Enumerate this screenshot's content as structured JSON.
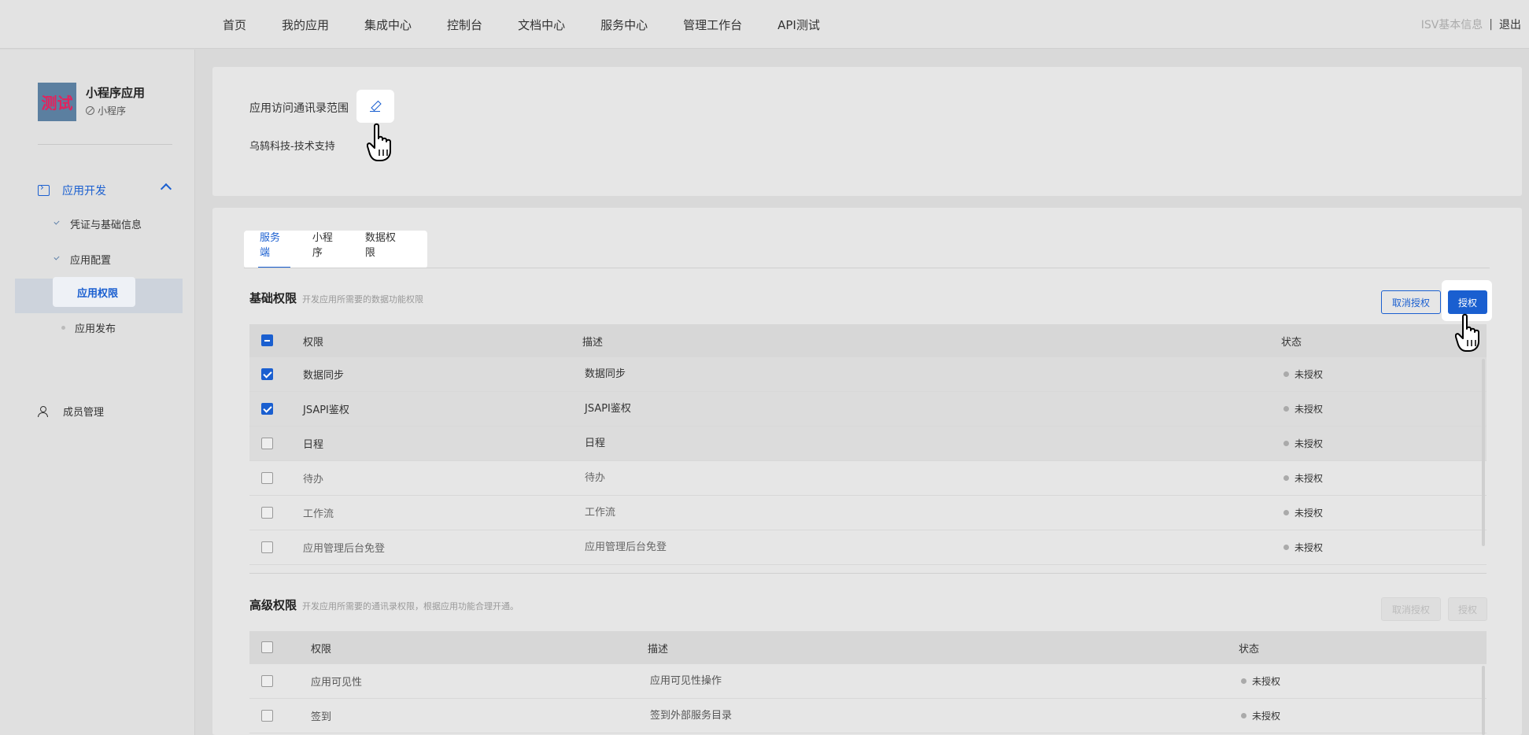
{
  "topnav": {
    "items": [
      "首页",
      "我的应用",
      "集成中心",
      "控制台",
      "文档中心",
      "服务中心",
      "管理工作台",
      "API测试"
    ],
    "isv": "ISV基本信息",
    "separator": "|",
    "logout": "退出"
  },
  "sidebar": {
    "app_logo_text": "测试",
    "app_name": "小程序应用",
    "app_type": "小程序",
    "group_label": "应用开发",
    "sub_items": [
      "凭证与基础信息",
      "应用配置",
      "应用权限",
      "应用发布"
    ],
    "member_label": "成员管理"
  },
  "scope": {
    "label": "应用访问通讯录范围",
    "value": "乌鸫科技-技术支持"
  },
  "tabs": [
    "服务端",
    "小程序",
    "数据权限"
  ],
  "basic": {
    "title": "基础权限",
    "desc": "开发应用所需要的数据功能权限",
    "cancel_label": "取消授权",
    "auth_label": "授权",
    "headers": [
      "权限",
      "描述",
      "状态"
    ],
    "rows": [
      {
        "name": "数据同步",
        "desc": "数据同步",
        "status": "未授权",
        "checked": true
      },
      {
        "name": "JSAPI鉴权",
        "desc": "JSAPI鉴权",
        "status": "未授权",
        "checked": true
      },
      {
        "name": "日程",
        "desc": "日程",
        "status": "未授权",
        "checked": false
      },
      {
        "name": "待办",
        "desc": "待办",
        "status": "未授权",
        "checked": false
      },
      {
        "name": "工作流",
        "desc": "工作流",
        "status": "未授权",
        "checked": false
      },
      {
        "name": "应用管理后台免登",
        "desc": "应用管理后台免登",
        "status": "未授权",
        "checked": false
      }
    ]
  },
  "advanced": {
    "title": "高级权限",
    "desc": "开发应用所需要的通讯录权限，根据应用功能合理开通。",
    "cancel_label": "取消授权",
    "auth_label": "授权",
    "headers": [
      "权限",
      "描述",
      "状态"
    ],
    "rows": [
      {
        "name": "应用可见性",
        "desc": "应用可见性操作",
        "status": "未授权"
      },
      {
        "name": "签到",
        "desc": "签到外部服务目录",
        "status": "未授权"
      }
    ]
  },
  "colors": {
    "accent": "#1a5fd0",
    "logo_bg": "#5b7fa0",
    "logo_text": "#e0245e"
  }
}
